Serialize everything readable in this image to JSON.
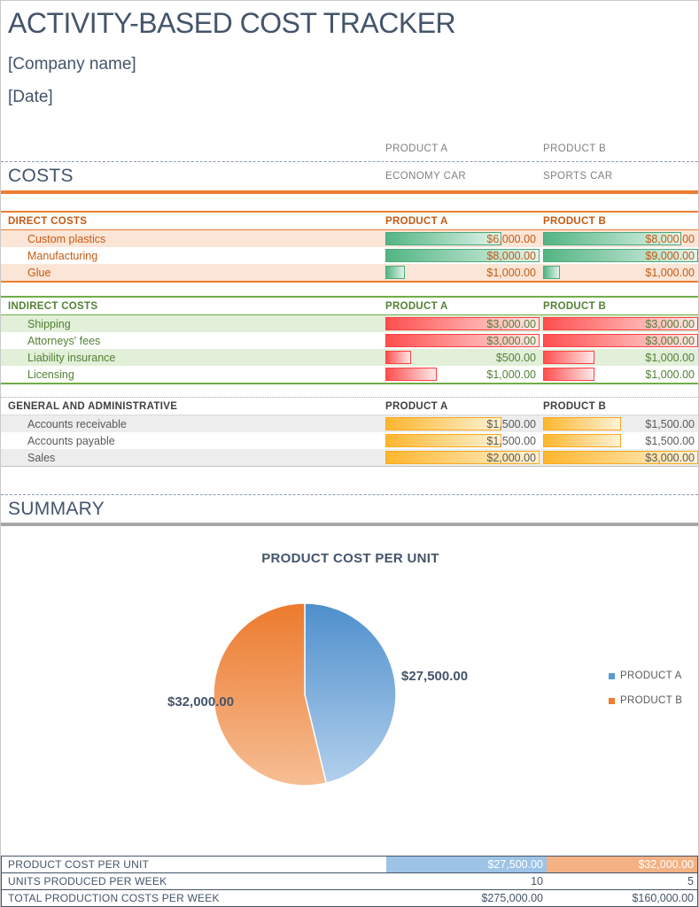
{
  "header": {
    "title": "ACTIVITY-BASED COST TRACKER",
    "company": "[Company name]",
    "date": "[Date]"
  },
  "intro_columns": {
    "product_a": "PRODUCT A",
    "product_b": "PRODUCT B"
  },
  "costs": {
    "section_title": "COSTS",
    "product_a_subtitle": "ECONOMY CAR",
    "product_b_subtitle": "SPORTS CAR",
    "direct": {
      "title": "DIRECT COSTS",
      "col_a": "PRODUCT A",
      "col_b": "PRODUCT B",
      "rows": [
        {
          "label": "Custom plastics",
          "a": "$6,000.00",
          "b": "$8,000.00",
          "a_pct": 75,
          "b_pct": 88.9
        },
        {
          "label": "Manufacturing",
          "a": "$8,000.00",
          "b": "$9,000.00",
          "a_pct": 100,
          "b_pct": 100
        },
        {
          "label": "Glue",
          "a": "$1,000.00",
          "b": "$1,000.00",
          "a_pct": 12.5,
          "b_pct": 11.1
        }
      ]
    },
    "indirect": {
      "title": "INDIRECT COSTS",
      "col_a": "PRODUCT A",
      "col_b": "PRODUCT B",
      "rows": [
        {
          "label": "Shipping",
          "a": "$3,000.00",
          "b": "$3,000.00",
          "a_pct": 100,
          "b_pct": 100
        },
        {
          "label": "Attorneys' fees",
          "a": "$3,000.00",
          "b": "$3,000.00",
          "a_pct": 100,
          "b_pct": 100
        },
        {
          "label": "Liability insurance",
          "a": "$500.00",
          "b": "$1,000.00",
          "a_pct": 16.7,
          "b_pct": 33.3
        },
        {
          "label": "Licensing",
          "a": "$1,000.00",
          "b": "$1,000.00",
          "a_pct": 33.3,
          "b_pct": 33.3
        }
      ]
    },
    "general": {
      "title": "GENERAL AND ADMINISTRATIVE",
      "col_a": "PRODUCT A",
      "col_b": "PRODUCT B",
      "rows": [
        {
          "label": "Accounts receivable",
          "a": "$1,500.00",
          "b": "$1,500.00",
          "a_pct": 75,
          "b_pct": 50
        },
        {
          "label": "Accounts payable",
          "a": "$1,500.00",
          "b": "$1,500.00",
          "a_pct": 75,
          "b_pct": 50
        },
        {
          "label": "Sales",
          "a": "$2,000.00",
          "b": "$3,000.00",
          "a_pct": 100,
          "b_pct": 100
        }
      ]
    }
  },
  "summary": {
    "section_title": "SUMMARY",
    "table": {
      "rows": [
        {
          "label": "PRODUCT COST PER UNIT",
          "a": "$27,500.00",
          "b": "$32,000.00"
        },
        {
          "label": "UNITS PRODUCED PER WEEK",
          "a": "10",
          "b": "5"
        },
        {
          "label": "TOTAL PRODUCTION COSTS PER WEEK",
          "a": "$275,000.00",
          "b": "$160,000.00"
        }
      ]
    }
  },
  "chart_data": {
    "type": "pie",
    "title": "PRODUCT COST PER UNIT",
    "labels": [
      "PRODUCT A",
      "PRODUCT B"
    ],
    "values": [
      27500,
      32000
    ],
    "data_labels": [
      "$27,500.00",
      "$32,000.00"
    ],
    "colors": [
      "#5B9BD5",
      "#ED7D31"
    ],
    "legend_position": "right",
    "start_angle": "top, clockwise"
  },
  "colors": {
    "accent_slate": "#44546A",
    "accent_orange": "#ED7D31",
    "orange_text": "#C55A11",
    "peach_bg": "#FBE5D6",
    "green_border": "#70AD47",
    "green_text": "#538135",
    "green_bg": "#E2EFD9",
    "gray_text": "#595959",
    "gray_bg": "#EDEDED",
    "bar_green": "#53B483",
    "bar_red": "#FF4E4E",
    "bar_yellow": "#FFB62E",
    "cell_blue": "#9DC3E6",
    "cell_orange": "#F4B183"
  }
}
